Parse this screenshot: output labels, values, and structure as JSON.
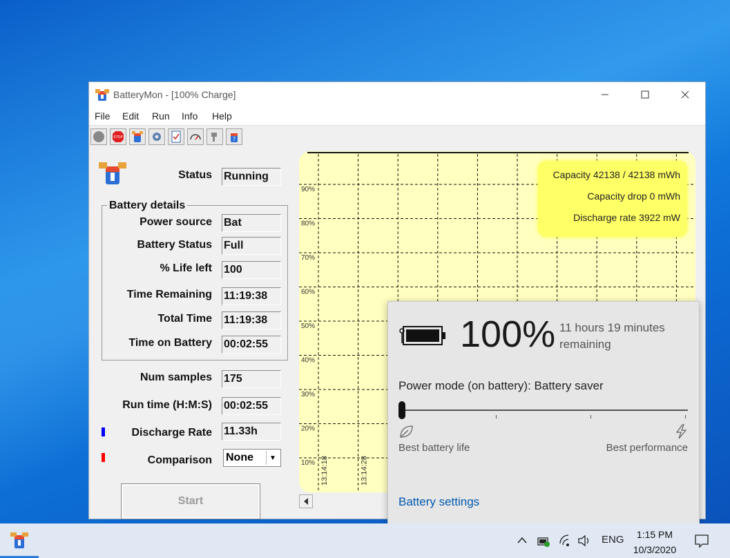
{
  "window": {
    "title": "BatteryMon - [100% Charge]",
    "menu": [
      "File",
      "Edit",
      "Run",
      "Info",
      "Help"
    ],
    "toolbar_icons": [
      "stop-circle-icon",
      "stop-sign-icon",
      "battery-icon",
      "settings-icon",
      "checklist-icon",
      "gauge-icon",
      "plug-icon",
      "help-icon"
    ]
  },
  "status": {
    "label": "Status",
    "value": "Running"
  },
  "battery_details": {
    "title": "Battery details",
    "rows": [
      {
        "label": "Power source",
        "value": "Bat"
      },
      {
        "label": "Battery Status",
        "value": "Full"
      },
      {
        "label": "% Life left",
        "value": "100"
      },
      {
        "label": "Time Remaining",
        "value": "11:19:38"
      },
      {
        "label": "Total Time",
        "value": "11:19:38"
      },
      {
        "label": "Time on Battery",
        "value": "00:02:55"
      }
    ]
  },
  "stats": {
    "num_samples": {
      "label": "Num samples",
      "value": "175"
    },
    "run_time": {
      "label": "Run time (H:M:S)",
      "value": "00:02:55"
    },
    "discharge_rate": {
      "label": "Discharge Rate",
      "value": "11.33h",
      "marker_color": "#0000ff"
    },
    "comparison": {
      "label": "Comparison",
      "value": "None",
      "marker_color": "#ff0000"
    }
  },
  "start_button": "Start",
  "chart_data": {
    "type": "line",
    "y_ticks": [
      "90%",
      "80%",
      "70%",
      "60%",
      "50%",
      "40%",
      "30%",
      "20%",
      "10%"
    ],
    "x_ticks": [
      "13:14:18",
      "13:14:28"
    ],
    "grid": true,
    "background": "#ffffc0",
    "annotations": [
      "Capacity 42138 / 42138 mWh",
      "Capacity drop 0 mWh",
      "Discharge rate 3922 mW"
    ]
  },
  "flyout": {
    "percent": "100%",
    "remaining": "11 hours 19 minutes remaining",
    "mode": "Power mode (on battery): Battery saver",
    "left_label": "Best battery life",
    "right_label": "Best performance",
    "settings_link": "Battery settings",
    "slider_position": 0
  },
  "taskbar": {
    "lang": "ENG",
    "time": "1:15 PM",
    "date": "10/3/2020"
  }
}
